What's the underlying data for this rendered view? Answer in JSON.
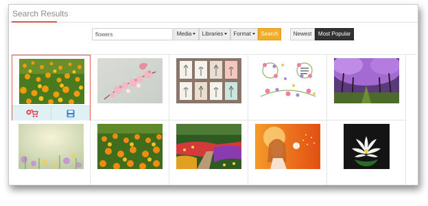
{
  "header": {
    "title": "Search Results"
  },
  "search": {
    "value": "flowers",
    "placeholder": "",
    "button_label": "Search"
  },
  "filters": {
    "media": "Media",
    "libraries": "Libraries",
    "format": "Format"
  },
  "sort": {
    "newest": "Newest",
    "most_popular": "Most Popular",
    "active": "Most Popular"
  },
  "colors": {
    "accent": "#d9534f",
    "search_button": "#f0ad2c",
    "active_sort": "#333333",
    "action_bar": "#dff1f2",
    "cart_icon": "#e0404a",
    "save_icon": "#3a7bd5"
  },
  "results": [
    {
      "id": "r1",
      "subject": "orange-marigold-field",
      "selected": true
    },
    {
      "id": "r2",
      "subject": "pink-cherry-blossoms"
    },
    {
      "id": "r3",
      "subject": "flower-illustration-cards"
    },
    {
      "id": "r4",
      "subject": "floral-wreath-clipart"
    },
    {
      "id": "r5",
      "subject": "purple-tree-tunnel"
    },
    {
      "id": "r6",
      "subject": "soft-focus-wildflowers"
    },
    {
      "id": "r7",
      "subject": "marigold-bed"
    },
    {
      "id": "r8",
      "subject": "garden-path-flowerbeds"
    },
    {
      "id": "r9",
      "subject": "woman-blowing-dandelion"
    },
    {
      "id": "r10",
      "subject": "white-water-lily"
    }
  ],
  "actions": {
    "cart_icon": "add-to-cart-icon",
    "save_icon": "save-icon"
  }
}
